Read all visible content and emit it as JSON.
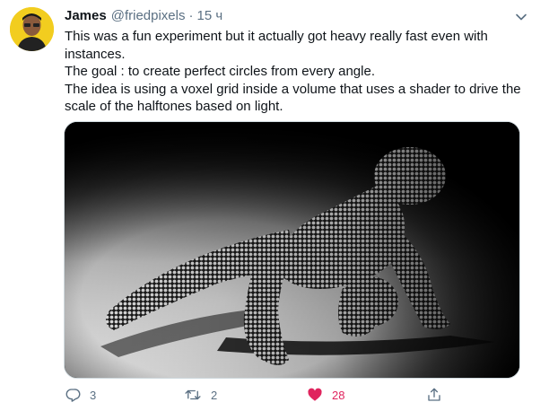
{
  "tweet": {
    "author_name": "James",
    "author_handle": "@friedpixels",
    "separator": "·",
    "time": "15 ч",
    "text_lines": [
      "This was a fun experiment but it actually got heavy really fast even with instances.",
      "The goal : to create perfect circles from every angle.",
      "The idea is using a voxel grid inside a volume that uses a shader to drive the scale of the halftones based on light."
    ],
    "media_icon": "halftone-render-image"
  },
  "actions": {
    "reply_count": "3",
    "retweet_count": "2",
    "like_count": "28",
    "reply_icon": "reply-icon",
    "retweet_icon": "retweet-icon",
    "like_icon": "heart-icon",
    "share_icon": "share-icon",
    "like_active": true
  },
  "colors": {
    "text": "#0f1419",
    "secondary": "#5b7083",
    "like": "#e0245e",
    "avatar_bg": "#f2cd1f"
  }
}
